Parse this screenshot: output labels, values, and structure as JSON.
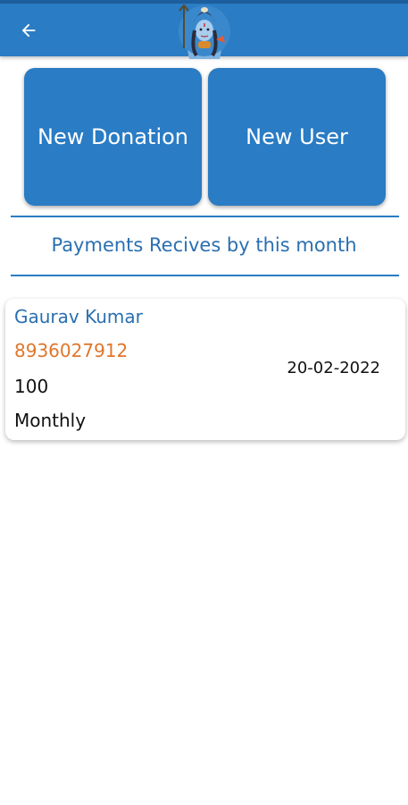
{
  "appbar": {
    "back_icon": "arrow-left-icon",
    "logo_icon": "shiva-deity-logo",
    "color": "#2a7cc4"
  },
  "actions": {
    "new_donation_label": "New Donation",
    "new_user_label": "New User"
  },
  "section": {
    "title": "Payments Recives by this month"
  },
  "payments": [
    {
      "name": "Gaurav Kumar",
      "phone": "8936027912",
      "amount": "100",
      "frequency": "Monthly",
      "date": "20-02-2022"
    }
  ],
  "colors": {
    "primary": "#2a7cc4",
    "title_text": "#2a6fb0",
    "phone_text": "#e0762a"
  }
}
